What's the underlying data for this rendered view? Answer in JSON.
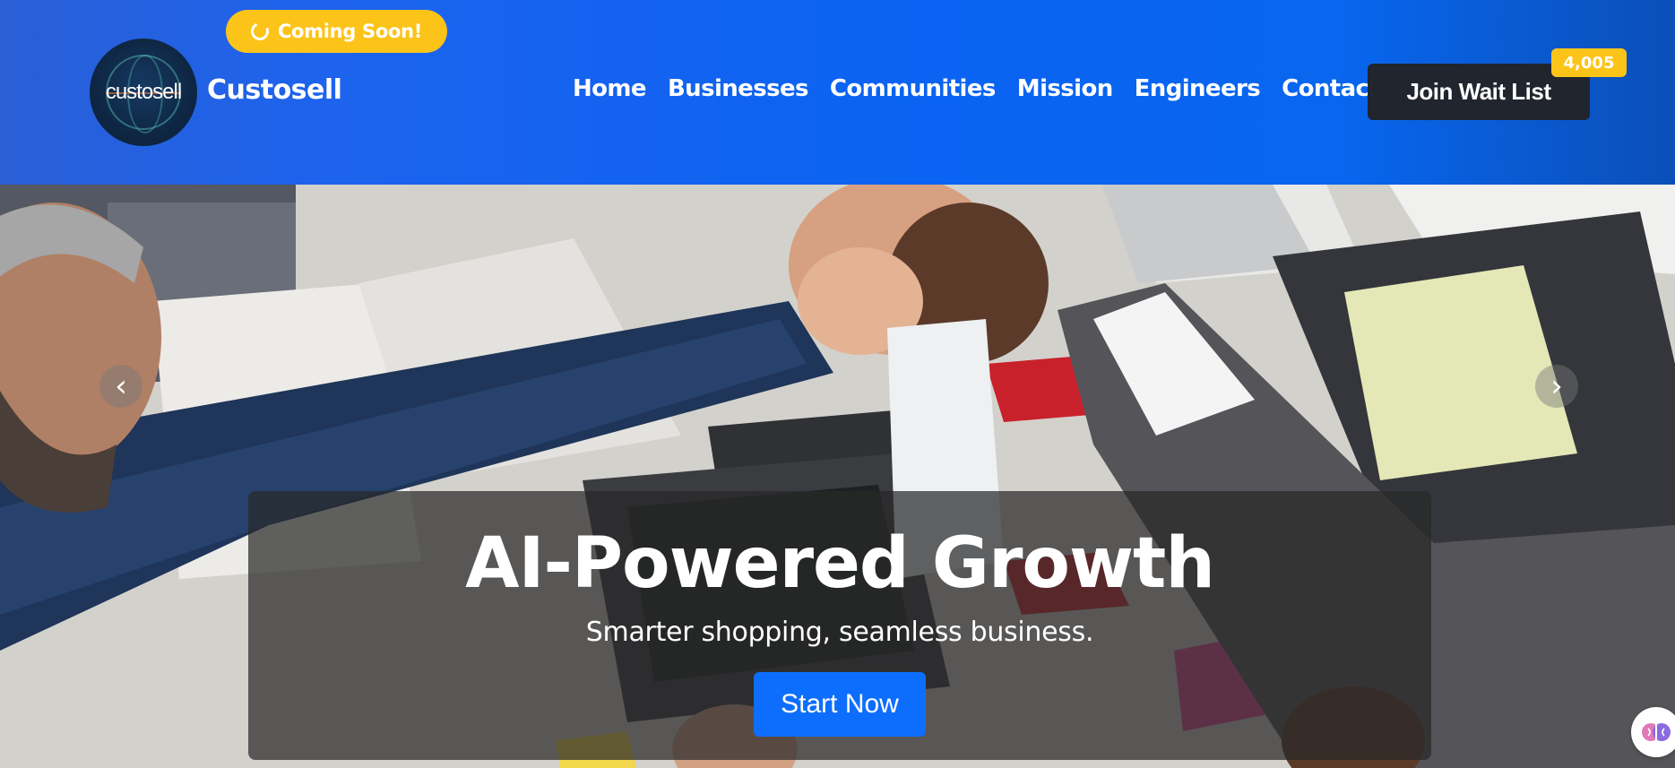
{
  "header": {
    "badge": {
      "label": "Coming Soon!",
      "icon": "spinner-icon",
      "color": "#fcc419"
    },
    "logo": {
      "text": "custosell"
    },
    "brand": "Custosell",
    "nav": [
      {
        "label": "Home"
      },
      {
        "label": "Businesses"
      },
      {
        "label": "Communities"
      },
      {
        "label": "Mission"
      },
      {
        "label": "Engineers"
      },
      {
        "label": "Contact"
      }
    ],
    "join_button": {
      "label": "Join Wait List",
      "color": "#20252e"
    },
    "waitlist_count": "4,005",
    "gradient_colors": [
      "#2a5fd6",
      "#0a63f2",
      "#0b4fb8"
    ]
  },
  "hero": {
    "title": "AI-Powered Growth",
    "subtitle": "Smarter shopping, seamless business.",
    "cta": {
      "label": "Start Now",
      "color": "#0d6efd"
    },
    "prev_arrow": "‹",
    "next_arrow": "›",
    "image": "team-high-five-over-desk-with-laptops"
  },
  "assistant": {
    "icon": "brain-icon"
  }
}
